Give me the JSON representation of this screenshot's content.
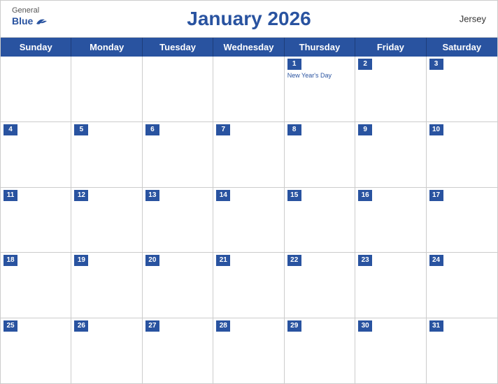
{
  "header": {
    "title": "January 2026",
    "region": "Jersey",
    "logo_general": "General",
    "logo_blue": "Blue"
  },
  "dayHeaders": [
    "Sunday",
    "Monday",
    "Tuesday",
    "Wednesday",
    "Thursday",
    "Friday",
    "Saturday"
  ],
  "weeks": [
    [
      {
        "day": "",
        "empty": true
      },
      {
        "day": "",
        "empty": true
      },
      {
        "day": "",
        "empty": true
      },
      {
        "day": "",
        "empty": true
      },
      {
        "day": "1",
        "holiday": "New Year's Day"
      },
      {
        "day": "2",
        "holiday": ""
      },
      {
        "day": "3",
        "holiday": ""
      }
    ],
    [
      {
        "day": "4",
        "holiday": ""
      },
      {
        "day": "5",
        "holiday": ""
      },
      {
        "day": "6",
        "holiday": ""
      },
      {
        "day": "7",
        "holiday": ""
      },
      {
        "day": "8",
        "holiday": ""
      },
      {
        "day": "9",
        "holiday": ""
      },
      {
        "day": "10",
        "holiday": ""
      }
    ],
    [
      {
        "day": "11",
        "holiday": ""
      },
      {
        "day": "12",
        "holiday": ""
      },
      {
        "day": "13",
        "holiday": ""
      },
      {
        "day": "14",
        "holiday": ""
      },
      {
        "day": "15",
        "holiday": ""
      },
      {
        "day": "16",
        "holiday": ""
      },
      {
        "day": "17",
        "holiday": ""
      }
    ],
    [
      {
        "day": "18",
        "holiday": ""
      },
      {
        "day": "19",
        "holiday": ""
      },
      {
        "day": "20",
        "holiday": ""
      },
      {
        "day": "21",
        "holiday": ""
      },
      {
        "day": "22",
        "holiday": ""
      },
      {
        "day": "23",
        "holiday": ""
      },
      {
        "day": "24",
        "holiday": ""
      }
    ],
    [
      {
        "day": "25",
        "holiday": ""
      },
      {
        "day": "26",
        "holiday": ""
      },
      {
        "day": "27",
        "holiday": ""
      },
      {
        "day": "28",
        "holiday": ""
      },
      {
        "day": "29",
        "holiday": ""
      },
      {
        "day": "30",
        "holiday": ""
      },
      {
        "day": "31",
        "holiday": ""
      }
    ]
  ]
}
